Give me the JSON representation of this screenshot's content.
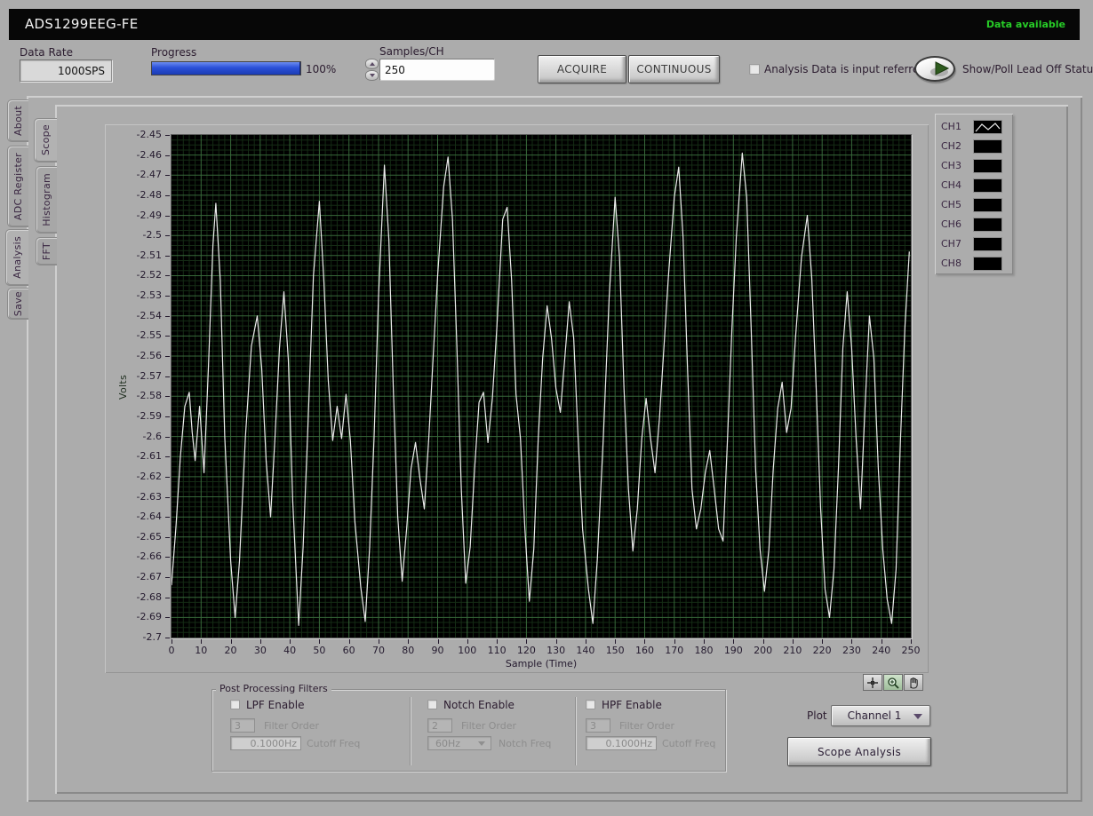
{
  "title_bar": {
    "title": "ADS1299EEG-FE",
    "status": "Data available",
    "status_color": "#27cc27"
  },
  "controls": {
    "data_rate": {
      "label": "Data Rate",
      "value": "1000SPS"
    },
    "progress": {
      "label": "Progress",
      "percent": 100,
      "percent_text": "100%"
    },
    "samples_per_ch": {
      "label": "Samples/CH",
      "value": "250"
    },
    "acquire_button": "ACQUIRE",
    "continuous_button": "CONTINUOUS",
    "analysis_checkbox_label": "Analysis Data is input referred",
    "lead_off_label": "Show/Poll Lead Off Status"
  },
  "tabs": {
    "outer": [
      {
        "label": "About",
        "selected": false
      },
      {
        "label": "ADC Register",
        "selected": false
      },
      {
        "label": "Analysis",
        "selected": true
      },
      {
        "label": "Save",
        "selected": false
      }
    ],
    "inner": [
      {
        "label": "Scope",
        "selected": true
      },
      {
        "label": "Histogram",
        "selected": false
      },
      {
        "label": "FFT",
        "selected": false
      }
    ]
  },
  "legend": {
    "channels": [
      {
        "label": "CH1",
        "has_waveform": true
      },
      {
        "label": "CH2",
        "has_waveform": false
      },
      {
        "label": "CH3",
        "has_waveform": false
      },
      {
        "label": "CH4",
        "has_waveform": false
      },
      {
        "label": "CH5",
        "has_waveform": false
      },
      {
        "label": "CH6",
        "has_waveform": false
      },
      {
        "label": "CH7",
        "has_waveform": false
      },
      {
        "label": "CH8",
        "has_waveform": false
      }
    ]
  },
  "graph_tools": {
    "cursor": "cursor-tool",
    "zoom": "zoom-tool",
    "pan": "pan-tool"
  },
  "filters": {
    "group_label": "Post Processing Filters",
    "lpf": {
      "enable_label": "LPF Enable",
      "order_value": "3",
      "order_label": "Filter Order",
      "freq_value": "0.1000Hz",
      "freq_label": "Cutoff Freq"
    },
    "notch": {
      "enable_label": "Notch Enable",
      "order_value": "2",
      "order_label": "Filter Order",
      "freq_value": "60Hz",
      "freq_label": "Notch Freq"
    },
    "hpf": {
      "enable_label": "HPF Enable",
      "order_value": "3",
      "order_label": "Filter Order",
      "freq_value": "0.1000Hz",
      "freq_label": "Cutoff Freq"
    }
  },
  "plot_select": {
    "label": "Plot",
    "value": "Channel 1"
  },
  "scope_analysis_button": "Scope Analysis",
  "chart_data": {
    "type": "line",
    "title": "",
    "xlabel": "Sample (Time)",
    "ylabel": "Volts",
    "xlim": [
      0,
      250
    ],
    "ylim": [
      -2.7,
      -2.45
    ],
    "grid": true,
    "legend_position": "right",
    "background_color": "#000000",
    "grid_minor_color": "#152c15",
    "grid_major_color": "#37683a",
    "line_color": "#ececec",
    "x_ticks": [
      "0",
      "10",
      "20",
      "30",
      "40",
      "50",
      "60",
      "70",
      "80",
      "90",
      "100",
      "110",
      "120",
      "130",
      "140",
      "150",
      "160",
      "170",
      "180",
      "190",
      "200",
      "210",
      "220",
      "230",
      "240",
      "250"
    ],
    "y_ticks": [
      "-2.45",
      "-2.46",
      "-2.47",
      "-2.48",
      "-2.49",
      "-2.5",
      "-2.51",
      "-2.52",
      "-2.53",
      "-2.54",
      "-2.55",
      "-2.56",
      "-2.57",
      "-2.58",
      "-2.59",
      "-2.6",
      "-2.61",
      "-2.62",
      "-2.63",
      "-2.64",
      "-2.65",
      "-2.66",
      "-2.67",
      "-2.68",
      "-2.69",
      "-2.7"
    ],
    "series": [
      {
        "name": "CH1",
        "points": [
          [
            0,
            -2.674
          ],
          [
            1.5,
            -2.645
          ],
          [
            3,
            -2.61
          ],
          [
            4.5,
            -2.585
          ],
          [
            6,
            -2.578
          ],
          [
            7,
            -2.598
          ],
          [
            8,
            -2.612
          ],
          [
            9.5,
            -2.585
          ],
          [
            11,
            -2.618
          ],
          [
            12.5,
            -2.565
          ],
          [
            14,
            -2.505
          ],
          [
            15,
            -2.484
          ],
          [
            16.5,
            -2.522
          ],
          [
            18,
            -2.6
          ],
          [
            20,
            -2.662
          ],
          [
            21.5,
            -2.69
          ],
          [
            23,
            -2.662
          ],
          [
            25,
            -2.6
          ],
          [
            27,
            -2.555
          ],
          [
            29,
            -2.54
          ],
          [
            30.5,
            -2.566
          ],
          [
            32,
            -2.612
          ],
          [
            33.5,
            -2.64
          ],
          [
            35,
            -2.6
          ],
          [
            36.5,
            -2.556
          ],
          [
            38,
            -2.528
          ],
          [
            39.5,
            -2.562
          ],
          [
            41,
            -2.632
          ],
          [
            43,
            -2.694
          ],
          [
            44.5,
            -2.655
          ],
          [
            46,
            -2.6
          ],
          [
            48,
            -2.52
          ],
          [
            50,
            -2.483
          ],
          [
            51.5,
            -2.522
          ],
          [
            53,
            -2.572
          ],
          [
            54.5,
            -2.602
          ],
          [
            56,
            -2.585
          ],
          [
            57.5,
            -2.601
          ],
          [
            59,
            -2.579
          ],
          [
            60.5,
            -2.602
          ],
          [
            62,
            -2.642
          ],
          [
            64,
            -2.675
          ],
          [
            65.5,
            -2.692
          ],
          [
            67,
            -2.655
          ],
          [
            68.5,
            -2.6
          ],
          [
            70,
            -2.53
          ],
          [
            72,
            -2.465
          ],
          [
            73.5,
            -2.502
          ],
          [
            75,
            -2.576
          ],
          [
            76.5,
            -2.64
          ],
          [
            78,
            -2.672
          ],
          [
            79.5,
            -2.646
          ],
          [
            81,
            -2.616
          ],
          [
            82.5,
            -2.603
          ],
          [
            84,
            -2.621
          ],
          [
            85.5,
            -2.636
          ],
          [
            87,
            -2.601
          ],
          [
            88.5,
            -2.56
          ],
          [
            90,
            -2.52
          ],
          [
            92,
            -2.476
          ],
          [
            93.5,
            -2.461
          ],
          [
            95,
            -2.492
          ],
          [
            96.5,
            -2.556
          ],
          [
            98,
            -2.626
          ],
          [
            99.5,
            -2.673
          ],
          [
            101,
            -2.655
          ],
          [
            102.5,
            -2.616
          ],
          [
            104,
            -2.583
          ],
          [
            105.5,
            -2.578
          ],
          [
            107,
            -2.603
          ],
          [
            108.5,
            -2.581
          ],
          [
            110,
            -2.546
          ],
          [
            112,
            -2.492
          ],
          [
            113.5,
            -2.486
          ],
          [
            115,
            -2.522
          ],
          [
            116.5,
            -2.579
          ],
          [
            118,
            -2.601
          ],
          [
            119.5,
            -2.646
          ],
          [
            121,
            -2.682
          ],
          [
            122.5,
            -2.656
          ],
          [
            124,
            -2.601
          ],
          [
            125.5,
            -2.561
          ],
          [
            127,
            -2.535
          ],
          [
            128.5,
            -2.551
          ],
          [
            130,
            -2.576
          ],
          [
            131.5,
            -2.588
          ],
          [
            133,
            -2.561
          ],
          [
            134.5,
            -2.533
          ],
          [
            136,
            -2.551
          ],
          [
            137.5,
            -2.601
          ],
          [
            139,
            -2.646
          ],
          [
            141,
            -2.676
          ],
          [
            142.5,
            -2.693
          ],
          [
            144,
            -2.661
          ],
          [
            146,
            -2.601
          ],
          [
            148,
            -2.531
          ],
          [
            150,
            -2.481
          ],
          [
            151.5,
            -2.511
          ],
          [
            153,
            -2.576
          ],
          [
            154.5,
            -2.626
          ],
          [
            156,
            -2.657
          ],
          [
            157.5,
            -2.636
          ],
          [
            159,
            -2.601
          ],
          [
            160.5,
            -2.581
          ],
          [
            162,
            -2.601
          ],
          [
            163.5,
            -2.618
          ],
          [
            165,
            -2.591
          ],
          [
            166.5,
            -2.556
          ],
          [
            168,
            -2.521
          ],
          [
            170,
            -2.481
          ],
          [
            171.5,
            -2.466
          ],
          [
            173,
            -2.501
          ],
          [
            174.5,
            -2.566
          ],
          [
            176,
            -2.626
          ],
          [
            177.5,
            -2.646
          ],
          [
            179,
            -2.636
          ],
          [
            180.5,
            -2.618
          ],
          [
            182,
            -2.607
          ],
          [
            183.5,
            -2.626
          ],
          [
            185,
            -2.646
          ],
          [
            186.5,
            -2.652
          ],
          [
            188,
            -2.601
          ],
          [
            189.5,
            -2.546
          ],
          [
            191,
            -2.501
          ],
          [
            193,
            -2.459
          ],
          [
            194.5,
            -2.481
          ],
          [
            196,
            -2.546
          ],
          [
            197.5,
            -2.616
          ],
          [
            199,
            -2.656
          ],
          [
            200.5,
            -2.677
          ],
          [
            202,
            -2.656
          ],
          [
            203.5,
            -2.616
          ],
          [
            205,
            -2.586
          ],
          [
            206.5,
            -2.573
          ],
          [
            208,
            -2.598
          ],
          [
            209.5,
            -2.586
          ],
          [
            211,
            -2.551
          ],
          [
            213,
            -2.511
          ],
          [
            215,
            -2.49
          ],
          [
            216.5,
            -2.521
          ],
          [
            218,
            -2.576
          ],
          [
            219.5,
            -2.636
          ],
          [
            221,
            -2.676
          ],
          [
            222.5,
            -2.69
          ],
          [
            224,
            -2.666
          ],
          [
            225.5,
            -2.616
          ],
          [
            227,
            -2.556
          ],
          [
            228.5,
            -2.528
          ],
          [
            230,
            -2.556
          ],
          [
            231.5,
            -2.601
          ],
          [
            233,
            -2.636
          ],
          [
            234.5,
            -2.586
          ],
          [
            236,
            -2.54
          ],
          [
            237.5,
            -2.561
          ],
          [
            239,
            -2.616
          ],
          [
            240.5,
            -2.656
          ],
          [
            242,
            -2.681
          ],
          [
            243.5,
            -2.693
          ],
          [
            245,
            -2.666
          ],
          [
            246.5,
            -2.601
          ],
          [
            248,
            -2.546
          ],
          [
            249.5,
            -2.508
          ]
        ]
      }
    ]
  }
}
